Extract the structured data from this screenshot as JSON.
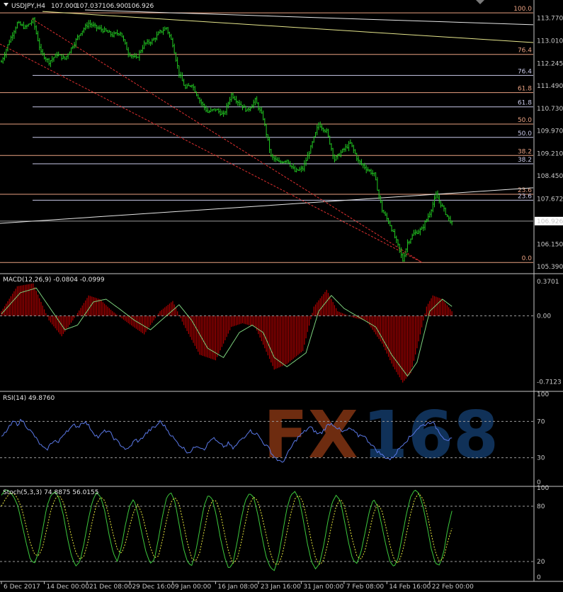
{
  "chart_data": [
    {
      "type": "bar",
      "panel": "price",
      "title": "USDJPY,H4",
      "ohlc_readout": [
        "107.000",
        "107.037",
        "106.900",
        "106.926"
      ],
      "current_price": 106.926,
      "current_price_label": "106.926",
      "ylim": [
        105.2,
        114.05
      ],
      "y_ticks": [
        "113.770",
        "113.010",
        "112.245",
        "111.490",
        "110.730",
        "109.970",
        "109.210",
        "108.450",
        "107.672",
        "106.926",
        "106.150",
        "105.390"
      ],
      "y_tick_values": [
        113.77,
        113.01,
        112.245,
        111.49,
        110.73,
        109.97,
        109.21,
        108.45,
        107.672,
        106.926,
        106.15,
        105.39
      ],
      "x_ticks": [
        "6 Dec 2017",
        "14 Dec 00:00",
        "21 Dec 08:00",
        "29 Dec 16:00",
        "9 Jan 00:00",
        "16 Jan 08:00",
        "23 Jan 16:00",
        "31 Jan 00:00",
        "7 Feb 08:00",
        "14 Feb 16:00",
        "22 Feb 00:00"
      ],
      "x_tick_index": [
        0,
        27,
        54,
        81,
        108,
        135,
        162,
        189,
        216,
        243,
        270
      ],
      "bar_count": 285,
      "close_path": [
        [
          0,
          112.3
        ],
        [
          5,
          113.0
        ],
        [
          10,
          113.6
        ],
        [
          15,
          113.45
        ],
        [
          20,
          113.7
        ],
        [
          25,
          112.6
        ],
        [
          30,
          112.3
        ],
        [
          35,
          112.55
        ],
        [
          40,
          112.4
        ],
        [
          45,
          112.85
        ],
        [
          50,
          113.3
        ],
        [
          55,
          113.6
        ],
        [
          60,
          113.45
        ],
        [
          65,
          113.35
        ],
        [
          70,
          113.2
        ],
        [
          75,
          113.3
        ],
        [
          80,
          112.6
        ],
        [
          85,
          112.4
        ],
        [
          90,
          112.9
        ],
        [
          95,
          113.0
        ],
        [
          100,
          113.3
        ],
        [
          104,
          113.45
        ],
        [
          108,
          112.9
        ],
        [
          112,
          111.9
        ],
        [
          116,
          111.4
        ],
        [
          120,
          111.55
        ],
        [
          125,
          111.0
        ],
        [
          130,
          110.6
        ],
        [
          135,
          110.7
        ],
        [
          140,
          110.5
        ],
        [
          145,
          111.2
        ],
        [
          150,
          110.9
        ],
        [
          155,
          110.65
        ],
        [
          160,
          111.0
        ],
        [
          165,
          110.4
        ],
        [
          170,
          109.1
        ],
        [
          175,
          108.9
        ],
        [
          180,
          109.0
        ],
        [
          185,
          108.6
        ],
        [
          190,
          108.7
        ],
        [
          195,
          109.4
        ],
        [
          200,
          110.2
        ],
        [
          205,
          109.95
        ],
        [
          210,
          109.0
        ],
        [
          215,
          109.3
        ],
        [
          220,
          109.55
        ],
        [
          225,
          108.95
        ],
        [
          230,
          108.7
        ],
        [
          235,
          108.5
        ],
        [
          240,
          107.3
        ],
        [
          245,
          106.8
        ],
        [
          250,
          106.1
        ],
        [
          253,
          105.6
        ],
        [
          256,
          106.2
        ],
        [
          260,
          106.5
        ],
        [
          265,
          106.65
        ],
        [
          270,
          107.2
        ],
        [
          274,
          107.8
        ],
        [
          278,
          107.4
        ],
        [
          282,
          107.0
        ],
        [
          286,
          106.7
        ],
        [
          290,
          106.85
        ],
        [
          294,
          106.7
        ],
        [
          298,
          107.0
        ],
        [
          302,
          106.926
        ]
      ],
      "fibonacci_sets": [
        {
          "color": "#e8a080",
          "levels": [
            {
              "label": "100.0",
              "price": 113.95
            },
            {
              "label": "76.4",
              "price": 112.55
            },
            {
              "label": "61.8",
              "price": 111.26
            },
            {
              "label": "50.0",
              "price": 110.2
            },
            {
              "label": "38.2",
              "price": 109.14
            },
            {
              "label": "23.6",
              "price": 107.83
            },
            {
              "label": "0.0",
              "price": 105.53
            }
          ]
        },
        {
          "color": "#c8c8e8",
          "levels": [
            {
              "label": "76.4",
              "price": 111.84
            },
            {
              "label": "61.8",
              "price": 110.78
            },
            {
              "label": "50.0",
              "price": 109.75
            },
            {
              "label": "38.2",
              "price": 108.86
            },
            {
              "label": "23.6",
              "price": 107.63
            }
          ]
        }
      ],
      "colors": {
        "bars": "#22cc22",
        "fib_a": "#e8a080",
        "fib_b": "#c8c8e8",
        "trend_white": "#e6e6e6",
        "trend_yellow": "#e6e68c",
        "trend_red": "#e03030"
      }
    },
    {
      "type": "bar",
      "panel": "macd",
      "title": "MACD(12,26,9) -0.0804 -0.0999",
      "ylim": [
        -0.8,
        0.44
      ],
      "y_ticks": [
        "0.3701",
        "0.00",
        "-0.7123"
      ],
      "y_tick_values": [
        0.3701,
        0.0,
        -0.7123
      ],
      "macd_path": [
        [
          0,
          0.05
        ],
        [
          10,
          0.32
        ],
        [
          20,
          0.35
        ],
        [
          30,
          -0.05
        ],
        [
          38,
          -0.22
        ],
        [
          45,
          -0.05
        ],
        [
          55,
          0.22
        ],
        [
          62,
          0.18
        ],
        [
          70,
          0.05
        ],
        [
          80,
          -0.08
        ],
        [
          90,
          -0.2
        ],
        [
          100,
          0.05
        ],
        [
          108,
          0.16
        ],
        [
          115,
          -0.1
        ],
        [
          125,
          -0.42
        ],
        [
          135,
          -0.48
        ],
        [
          145,
          -0.12
        ],
        [
          152,
          -0.08
        ],
        [
          160,
          -0.12
        ],
        [
          166,
          -0.35
        ],
        [
          172,
          -0.58
        ],
        [
          180,
          -0.52
        ],
        [
          190,
          -0.38
        ],
        [
          197,
          0.1
        ],
        [
          205,
          0.28
        ],
        [
          212,
          0.05
        ],
        [
          222,
          -0.02
        ],
        [
          230,
          -0.05
        ],
        [
          240,
          -0.3
        ],
        [
          247,
          -0.55
        ],
        [
          253,
          -0.72
        ],
        [
          258,
          -0.62
        ],
        [
          262,
          -0.35
        ],
        [
          268,
          0.1
        ],
        [
          272,
          0.22
        ],
        [
          278,
          0.18
        ],
        [
          284,
          0.05
        ],
        [
          292,
          -0.02
        ],
        [
          300,
          -0.08
        ]
      ],
      "signal_path": [
        [
          0,
          0.02
        ],
        [
          12,
          0.25
        ],
        [
          22,
          0.3
        ],
        [
          32,
          0.05
        ],
        [
          40,
          -0.15
        ],
        [
          48,
          -0.1
        ],
        [
          58,
          0.15
        ],
        [
          66,
          0.18
        ],
        [
          74,
          0.08
        ],
        [
          84,
          -0.05
        ],
        [
          94,
          -0.15
        ],
        [
          104,
          0.0
        ],
        [
          112,
          0.12
        ],
        [
          120,
          -0.05
        ],
        [
          130,
          -0.35
        ],
        [
          140,
          -0.45
        ],
        [
          150,
          -0.18
        ],
        [
          158,
          -0.1
        ],
        [
          165,
          -0.18
        ],
        [
          172,
          -0.45
        ],
        [
          180,
          -0.55
        ],
        [
          192,
          -0.4
        ],
        [
          200,
          0.05
        ],
        [
          208,
          0.22
        ],
        [
          216,
          0.08
        ],
        [
          226,
          -0.02
        ],
        [
          236,
          -0.12
        ],
        [
          246,
          -0.42
        ],
        [
          256,
          -0.65
        ],
        [
          262,
          -0.5
        ],
        [
          270,
          0.05
        ],
        [
          278,
          0.18
        ],
        [
          288,
          0.05
        ],
        [
          300,
          -0.1
        ]
      ],
      "colors": {
        "histogram": "#b40000",
        "signal": "#7cd07c"
      }
    },
    {
      "type": "line",
      "panel": "rsi",
      "title": "RSI(14) 49.8760",
      "ylim": [
        0,
        100
      ],
      "y_ticks": [
        "100",
        "70",
        "30",
        "0"
      ],
      "y_tick_values": [
        100,
        70,
        30,
        0
      ],
      "series": [
        {
          "values": [
            52,
            58,
            64,
            70,
            67,
            72,
            66,
            60,
            55,
            48,
            42,
            38,
            44,
            50,
            46,
            54,
            60,
            62,
            66,
            64,
            70,
            68,
            62,
            56,
            52,
            58,
            60,
            56,
            50,
            46,
            42,
            38,
            44,
            50,
            48,
            54,
            58,
            62,
            64,
            70,
            66,
            60,
            54,
            48,
            44,
            40,
            36,
            38,
            44,
            42,
            40,
            46,
            52,
            48,
            44,
            42,
            46,
            40,
            44,
            50,
            54,
            60,
            58,
            56,
            50,
            44,
            40,
            32,
            28,
            24,
            30,
            38,
            46,
            52,
            56,
            60,
            64,
            60,
            56,
            58,
            64,
            68,
            66,
            62,
            58,
            60,
            62,
            58,
            54,
            56,
            50,
            46,
            40,
            36,
            32,
            30,
            28,
            34,
            40,
            46,
            50,
            54,
            60,
            64,
            66,
            68,
            70,
            64,
            58,
            52,
            50,
            49.876
          ]
        }
      ],
      "colors": {
        "line": "#5a78e6",
        "levels": "#9a9a9a"
      }
    },
    {
      "type": "line",
      "panel": "stoch",
      "title": "Stoch(5,3,3) 74.8875 56.0155",
      "ylim": [
        0,
        100
      ],
      "y_ticks": [
        "100",
        "80",
        "20",
        "0"
      ],
      "y_tick_values": [
        100,
        80,
        20,
        0
      ],
      "series": [
        {
          "values": [
            92,
            98,
            96,
            90,
            80,
            60,
            40,
            22,
            18,
            30,
            55,
            80,
            92,
            96,
            88,
            70,
            45,
            25,
            15,
            20,
            40,
            65,
            85,
            95,
            90,
            75,
            50,
            30,
            20,
            35,
            60,
            80,
            88,
            72,
            50,
            30,
            18,
            22,
            45,
            70,
            90,
            95,
            85,
            60,
            35,
            20,
            15,
            30,
            55,
            80,
            92,
            88,
            70,
            45,
            25,
            12,
            18,
            40,
            66,
            86,
            94,
            90,
            72,
            48,
            26,
            14,
            10,
            24,
            50,
            76,
            92,
            96,
            88,
            66,
            40,
            20,
            12,
            18,
            38,
            64,
            84,
            92,
            86,
            64,
            40,
            22,
            18,
            30,
            52,
            74,
            88,
            80,
            60,
            38,
            20,
            14,
            24,
            48,
            72,
            90,
            98,
            94,
            80,
            58,
            34,
            18,
            16,
            30,
            56,
            74.8875
          ]
        },
        {
          "values": [
            80,
            88,
            94,
            94,
            88,
            76,
            58,
            40,
            28,
            26,
            36,
            56,
            76,
            88,
            92,
            84,
            66,
            46,
            30,
            22,
            26,
            42,
            64,
            82,
            90,
            86,
            70,
            50,
            34,
            28,
            40,
            58,
            74,
            82,
            72,
            54,
            36,
            24,
            26,
            44,
            66,
            84,
            90,
            82,
            62,
            40,
            24,
            20,
            30,
            52,
            74,
            86,
            86,
            72,
            50,
            30,
            18,
            22,
            40,
            62,
            82,
            90,
            86,
            70,
            50,
            30,
            18,
            16,
            28,
            50,
            72,
            88,
            92,
            84,
            64,
            42,
            24,
            16,
            22,
            40,
            62,
            80,
            88,
            80,
            62,
            42,
            26,
            22,
            32,
            52,
            72,
            82,
            76,
            58,
            38,
            22,
            18,
            30,
            50,
            72,
            88,
            94,
            88,
            72,
            50,
            30,
            20,
            24,
            42,
            56.0155
          ]
        }
      ],
      "colors": {
        "main": "#3cc83c",
        "signal": "#e6e63c",
        "levels": "#9a9a9a"
      }
    }
  ],
  "watermark": "FX168"
}
